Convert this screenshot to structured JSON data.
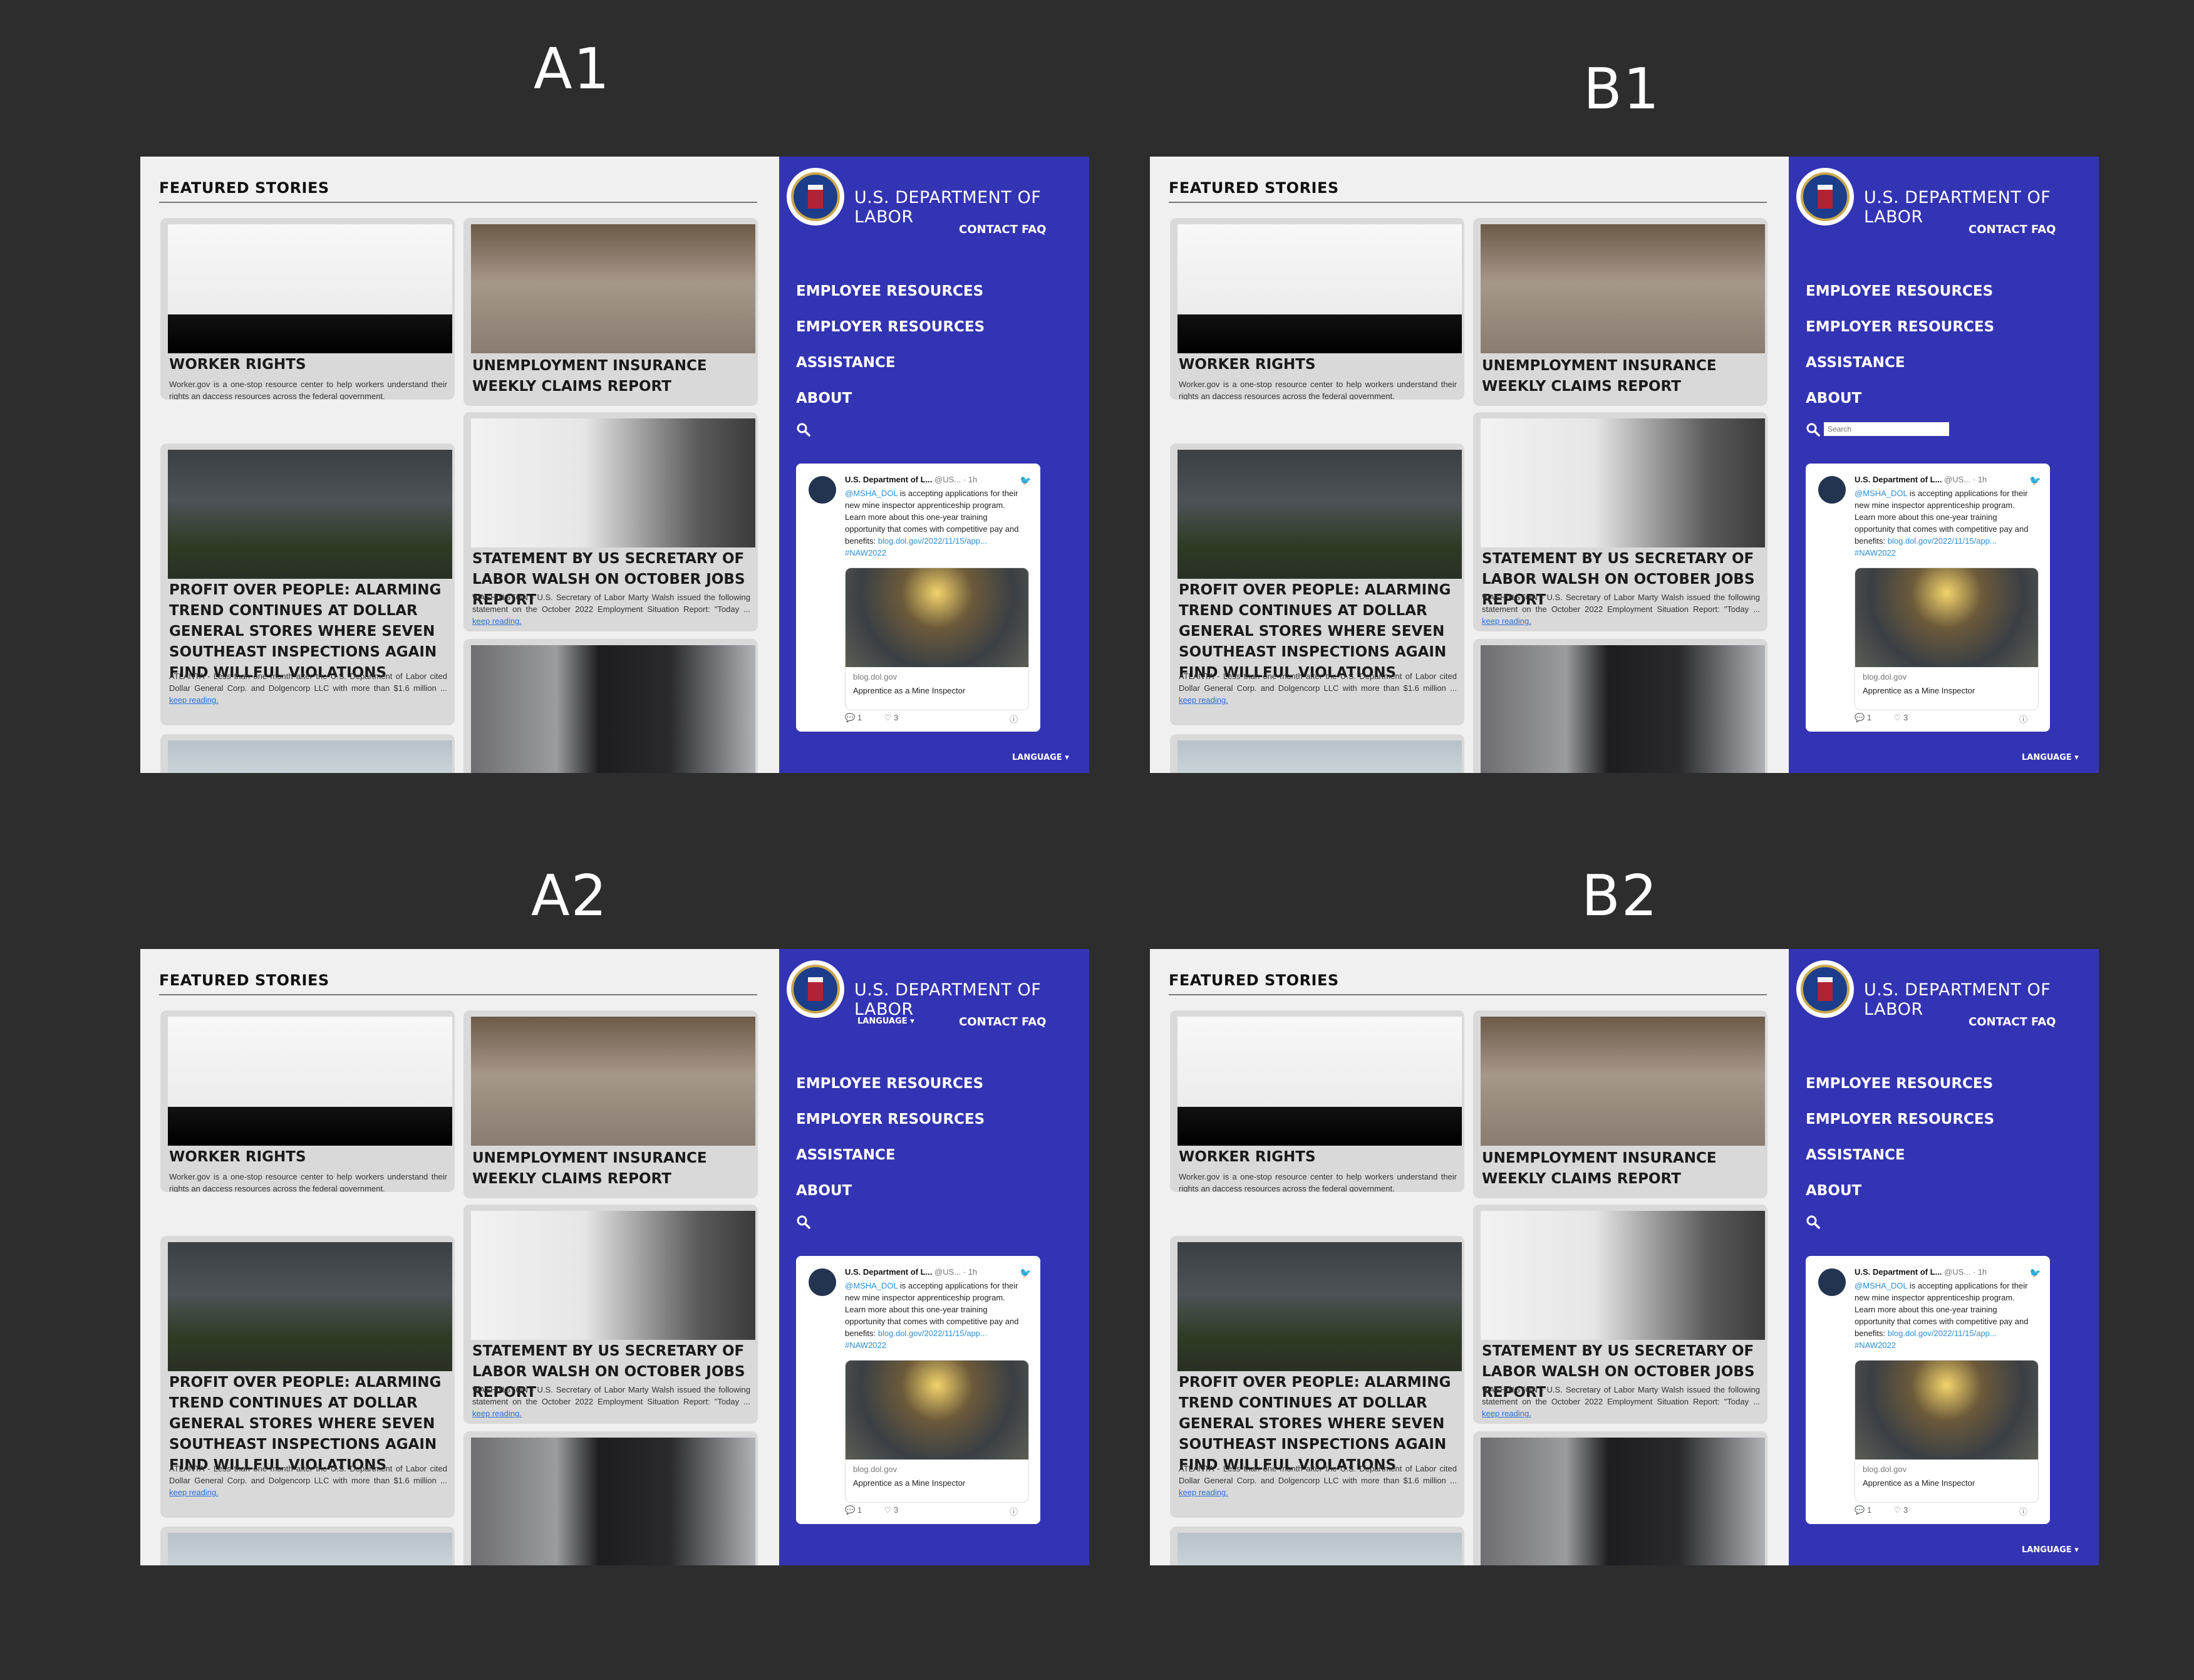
{
  "variants": [
    {
      "label": "A1",
      "search_placeholder": ""
    },
    {
      "label": "B1",
      "search_placeholder": "Search"
    },
    {
      "label": "A2",
      "search_placeholder": ""
    },
    {
      "label": "B2",
      "search_placeholder": ""
    }
  ],
  "content": {
    "section_title": "FEATURED STORIES",
    "cards": {
      "worker_rights": {
        "title": "WORKER RIGHTS",
        "body": "Worker.gov is a one-stop resource center to help workers understand their rights an daccess resources across the federal government."
      },
      "unemployment": {
        "title": "UNEMPLOYMENT INSURANCE WEEKLY CLAIMS REPORT"
      },
      "dollar_general": {
        "title": "PROFIT OVER PEOPLE: ALARMING TREND CONTINUES AT DOLLAR GENERAL STORES WHERE SEVEN SOUTHEAST INSPECTIONS AGAIN FIND WILLFUL VIOLATIONS",
        "body": "ATLANTA - Less than one month after the U.S. Department of Labor cited Dollar General Corp. and Dolgencorp LLC with more than $1.6 million ...",
        "link": "keep reading."
      },
      "walsh": {
        "title": "STATEMENT BY US SECRETARY OF LABOR WALSH ON OCTOBER JOBS REPORT",
        "body": "WASHINGTON - U.S. Secretary of Labor Marty Walsh issued the following statement on the October 2022 Employment Situation Report: \"Today ...",
        "link": "keep reading."
      }
    }
  },
  "sidebar": {
    "title": "U.S. DEPARTMENT OF LABOR",
    "contact": "CONTACT",
    "faq": "FAQ",
    "language": "LANGUAGE ▾",
    "nav": {
      "employee": "EMPLOYEE RESOURCES",
      "employer": "EMPLOYER RESOURCES",
      "assistance": "ASSISTANCE",
      "about": "ABOUT"
    }
  },
  "tweet": {
    "name": "U.S. Department of L...",
    "handle": "@US...",
    "time": "· 1h",
    "mention": "@MSHA_DOL",
    "text": " is accepting applications for their new mine inspector apprenticeship program. Learn more about this one-year training opportunity that comes with competitive pay and benefits:",
    "url": "blog.dol.gov/2022/11/15/app...",
    "hashtag": "#NAW2022",
    "card_domain": "blog.dol.gov",
    "card_title": "Apprentice as a Mine Inspector",
    "replies": "1",
    "likes": "3",
    "info": "ⓘ"
  },
  "colors": {
    "sidebar_bg": "#3334b3",
    "page_bg": "#2d2d2d",
    "link": "#2a6fd6"
  }
}
